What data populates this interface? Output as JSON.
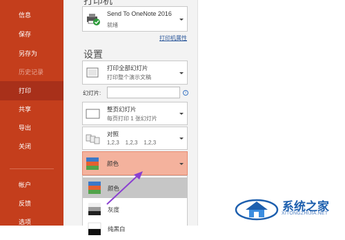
{
  "sidebar": {
    "items": [
      {
        "label": "信息"
      },
      {
        "label": "保存"
      },
      {
        "label": "另存为"
      },
      {
        "label": "历史记录"
      },
      {
        "label": "打印"
      },
      {
        "label": "共享"
      },
      {
        "label": "导出"
      },
      {
        "label": "关闭"
      }
    ],
    "bottom_items": [
      {
        "label": "帐户"
      },
      {
        "label": "反馈"
      },
      {
        "label": "选项"
      }
    ]
  },
  "printer": {
    "heading": "打印机",
    "name": "Send To OneNote 2016",
    "status": "就绪",
    "properties_link": "打印机属性"
  },
  "settings": {
    "heading": "设置",
    "range": {
      "title": "打印全部幻灯片",
      "subtitle": "打印整个演示文稿"
    },
    "slides_label": "幻灯片:",
    "slides_value": "",
    "info_icon": "info-icon",
    "layout": {
      "title": "整页幻灯片",
      "subtitle": "每页打印 1 张幻灯片"
    },
    "collate": {
      "title": "对照",
      "subtitle": "1,2,3    1,2,3    1,2,3"
    },
    "color": {
      "title": "颜色"
    }
  },
  "color_menu": {
    "items": [
      {
        "label": "颜色",
        "selected": true
      },
      {
        "label": "灰度",
        "selected": false
      },
      {
        "label": "纯黑白",
        "selected": false
      }
    ]
  },
  "watermark": {
    "text": "系统之家",
    "url": "XITONGZHIJIA.NET"
  },
  "colors": {
    "sidebar_bg": "#c43e1c",
    "sidebar_selected": "#a8301a",
    "dropdown_highlight": "#f4b29d",
    "menu_selected": "#c6c6c6",
    "arrow": "#8a3fd1"
  }
}
